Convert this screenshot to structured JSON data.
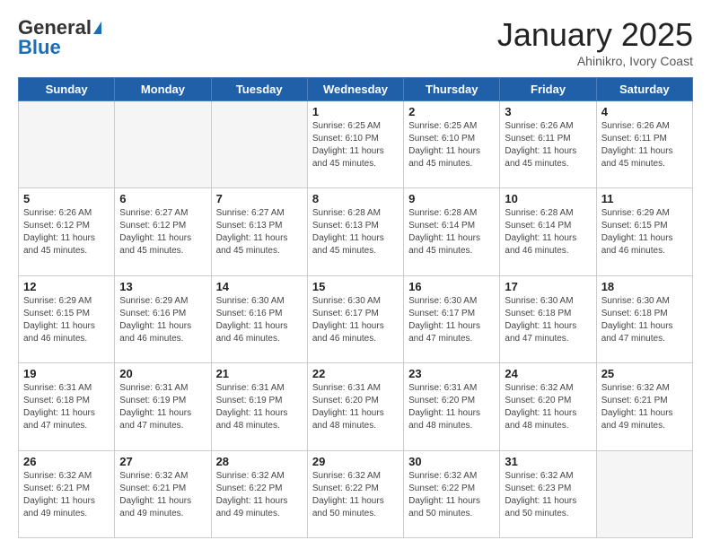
{
  "header": {
    "logo_general": "General",
    "logo_blue": "Blue",
    "month_title": "January 2025",
    "subtitle": "Ahinikro, Ivory Coast"
  },
  "weekdays": [
    "Sunday",
    "Monday",
    "Tuesday",
    "Wednesday",
    "Thursday",
    "Friday",
    "Saturday"
  ],
  "weeks": [
    [
      {
        "day": "",
        "info": ""
      },
      {
        "day": "",
        "info": ""
      },
      {
        "day": "",
        "info": ""
      },
      {
        "day": "1",
        "info": "Sunrise: 6:25 AM\nSunset: 6:10 PM\nDaylight: 11 hours and 45 minutes."
      },
      {
        "day": "2",
        "info": "Sunrise: 6:25 AM\nSunset: 6:10 PM\nDaylight: 11 hours and 45 minutes."
      },
      {
        "day": "3",
        "info": "Sunrise: 6:26 AM\nSunset: 6:11 PM\nDaylight: 11 hours and 45 minutes."
      },
      {
        "day": "4",
        "info": "Sunrise: 6:26 AM\nSunset: 6:11 PM\nDaylight: 11 hours and 45 minutes."
      }
    ],
    [
      {
        "day": "5",
        "info": "Sunrise: 6:26 AM\nSunset: 6:12 PM\nDaylight: 11 hours and 45 minutes."
      },
      {
        "day": "6",
        "info": "Sunrise: 6:27 AM\nSunset: 6:12 PM\nDaylight: 11 hours and 45 minutes."
      },
      {
        "day": "7",
        "info": "Sunrise: 6:27 AM\nSunset: 6:13 PM\nDaylight: 11 hours and 45 minutes."
      },
      {
        "day": "8",
        "info": "Sunrise: 6:28 AM\nSunset: 6:13 PM\nDaylight: 11 hours and 45 minutes."
      },
      {
        "day": "9",
        "info": "Sunrise: 6:28 AM\nSunset: 6:14 PM\nDaylight: 11 hours and 45 minutes."
      },
      {
        "day": "10",
        "info": "Sunrise: 6:28 AM\nSunset: 6:14 PM\nDaylight: 11 hours and 46 minutes."
      },
      {
        "day": "11",
        "info": "Sunrise: 6:29 AM\nSunset: 6:15 PM\nDaylight: 11 hours and 46 minutes."
      }
    ],
    [
      {
        "day": "12",
        "info": "Sunrise: 6:29 AM\nSunset: 6:15 PM\nDaylight: 11 hours and 46 minutes."
      },
      {
        "day": "13",
        "info": "Sunrise: 6:29 AM\nSunset: 6:16 PM\nDaylight: 11 hours and 46 minutes."
      },
      {
        "day": "14",
        "info": "Sunrise: 6:30 AM\nSunset: 6:16 PM\nDaylight: 11 hours and 46 minutes."
      },
      {
        "day": "15",
        "info": "Sunrise: 6:30 AM\nSunset: 6:17 PM\nDaylight: 11 hours and 46 minutes."
      },
      {
        "day": "16",
        "info": "Sunrise: 6:30 AM\nSunset: 6:17 PM\nDaylight: 11 hours and 47 minutes."
      },
      {
        "day": "17",
        "info": "Sunrise: 6:30 AM\nSunset: 6:18 PM\nDaylight: 11 hours and 47 minutes."
      },
      {
        "day": "18",
        "info": "Sunrise: 6:30 AM\nSunset: 6:18 PM\nDaylight: 11 hours and 47 minutes."
      }
    ],
    [
      {
        "day": "19",
        "info": "Sunrise: 6:31 AM\nSunset: 6:18 PM\nDaylight: 11 hours and 47 minutes."
      },
      {
        "day": "20",
        "info": "Sunrise: 6:31 AM\nSunset: 6:19 PM\nDaylight: 11 hours and 47 minutes."
      },
      {
        "day": "21",
        "info": "Sunrise: 6:31 AM\nSunset: 6:19 PM\nDaylight: 11 hours and 48 minutes."
      },
      {
        "day": "22",
        "info": "Sunrise: 6:31 AM\nSunset: 6:20 PM\nDaylight: 11 hours and 48 minutes."
      },
      {
        "day": "23",
        "info": "Sunrise: 6:31 AM\nSunset: 6:20 PM\nDaylight: 11 hours and 48 minutes."
      },
      {
        "day": "24",
        "info": "Sunrise: 6:32 AM\nSunset: 6:20 PM\nDaylight: 11 hours and 48 minutes."
      },
      {
        "day": "25",
        "info": "Sunrise: 6:32 AM\nSunset: 6:21 PM\nDaylight: 11 hours and 49 minutes."
      }
    ],
    [
      {
        "day": "26",
        "info": "Sunrise: 6:32 AM\nSunset: 6:21 PM\nDaylight: 11 hours and 49 minutes."
      },
      {
        "day": "27",
        "info": "Sunrise: 6:32 AM\nSunset: 6:21 PM\nDaylight: 11 hours and 49 minutes."
      },
      {
        "day": "28",
        "info": "Sunrise: 6:32 AM\nSunset: 6:22 PM\nDaylight: 11 hours and 49 minutes."
      },
      {
        "day": "29",
        "info": "Sunrise: 6:32 AM\nSunset: 6:22 PM\nDaylight: 11 hours and 50 minutes."
      },
      {
        "day": "30",
        "info": "Sunrise: 6:32 AM\nSunset: 6:22 PM\nDaylight: 11 hours and 50 minutes."
      },
      {
        "day": "31",
        "info": "Sunrise: 6:32 AM\nSunset: 6:23 PM\nDaylight: 11 hours and 50 minutes."
      },
      {
        "day": "",
        "info": ""
      }
    ]
  ]
}
